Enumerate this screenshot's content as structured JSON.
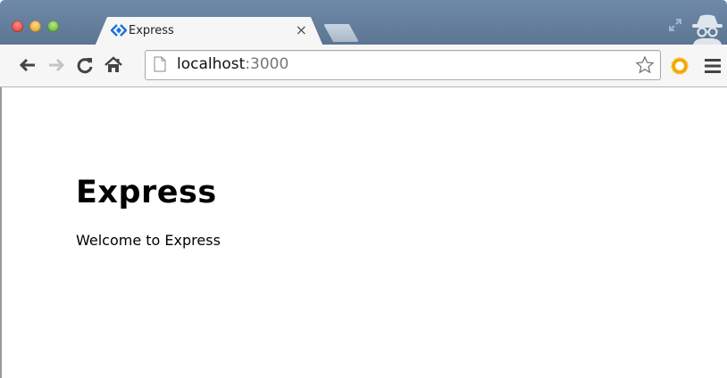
{
  "tab": {
    "title": "Express",
    "close_label": "×",
    "favicon": "express-chevrons-icon"
  },
  "omnibox": {
    "host": "localhost",
    "port": ":3000"
  },
  "toolbar": {
    "back": "arrow-left-icon",
    "forward": "arrow-right-icon",
    "reload": "reload-icon",
    "home": "home-icon",
    "bookmark": "star-icon",
    "extension": "sun-icon",
    "menu": "hamburger-menu-icon"
  },
  "page": {
    "heading": "Express",
    "message": "Welcome to Express"
  },
  "colors": {
    "titlebar": "#5b7593",
    "toolbar": "#f6f6f6",
    "favicon": "#1e73d8",
    "extension": "#f5a800"
  }
}
